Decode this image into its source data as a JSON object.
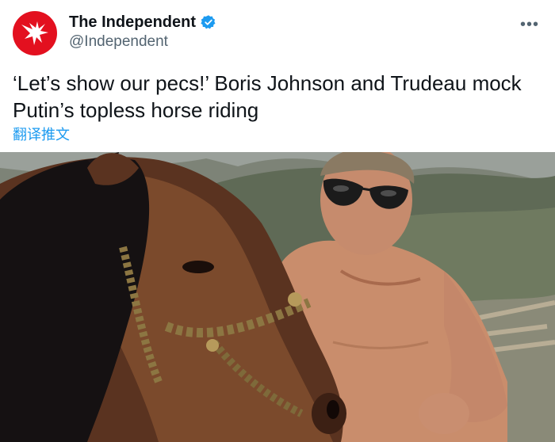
{
  "account": {
    "display_name": "The Independent",
    "handle": "@Independent",
    "verified": true,
    "avatar_icon": "independent-eagle-logo",
    "brand_color": "#e3101f"
  },
  "menu": {
    "more_label": "•••"
  },
  "tweet": {
    "text": "‘Let’s show our pecs!’ Boris Johnson and Trudeau mock Putin’s topless horse riding",
    "translate_label": "翻译推文"
  },
  "media": {
    "type": "photo",
    "subject": "shirtless man in sunglasses beside a brown horse with a beaded bridle"
  },
  "colors": {
    "link": "#1d9bf0",
    "secondary_text": "#536471",
    "verified_badge": "#1d9bf0"
  }
}
